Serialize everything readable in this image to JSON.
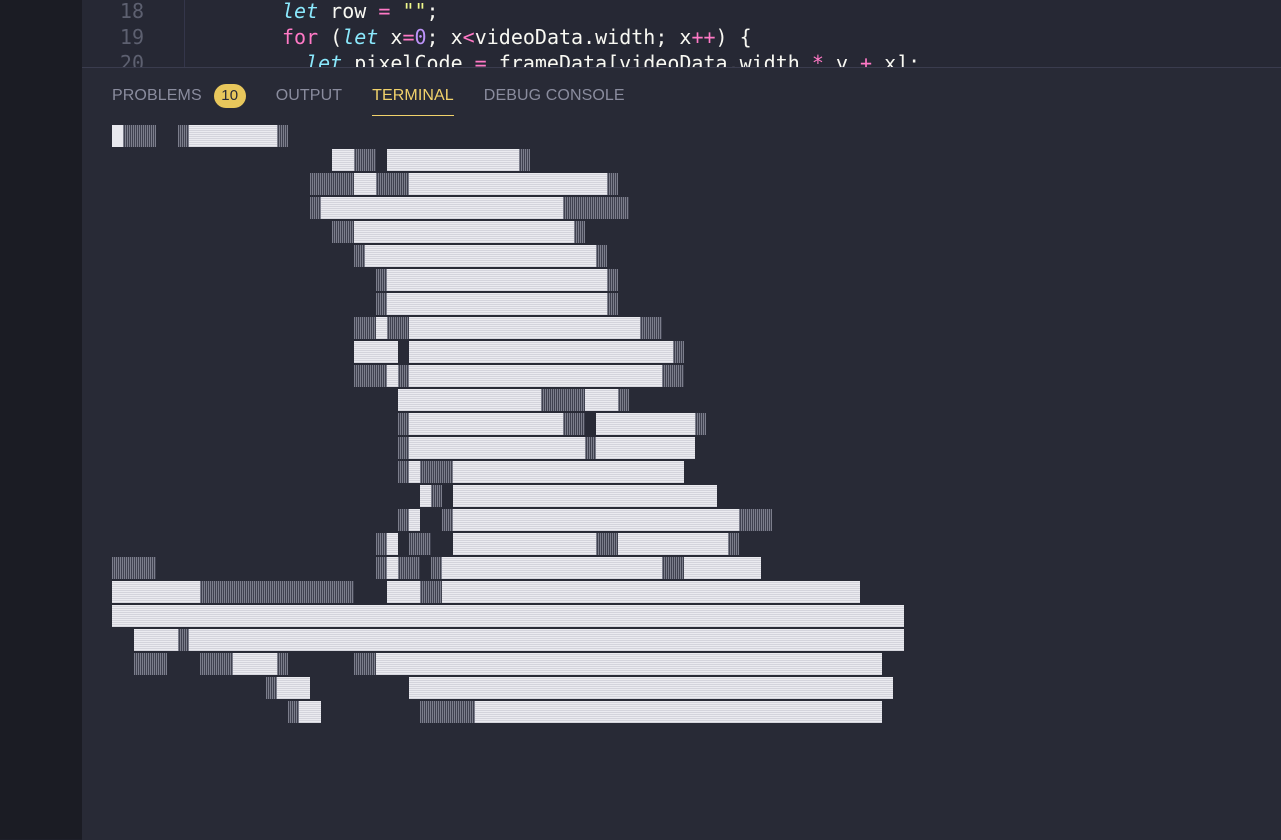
{
  "editor": {
    "lines": [
      {
        "number": "18",
        "tokens": [
          {
            "c": "kw-let",
            "t": "let"
          },
          {
            "c": "",
            "t": " row "
          },
          {
            "c": "op",
            "t": "="
          },
          {
            "c": "",
            "t": " "
          },
          {
            "c": "str",
            "t": "\"\""
          },
          {
            "c": "",
            "t": ";"
          }
        ]
      },
      {
        "number": "19",
        "tokens": [
          {
            "c": "kw-for",
            "t": "for"
          },
          {
            "c": "",
            "t": " ("
          },
          {
            "c": "kw-let",
            "t": "let"
          },
          {
            "c": "",
            "t": " x"
          },
          {
            "c": "op",
            "t": "="
          },
          {
            "c": "num",
            "t": "0"
          },
          {
            "c": "",
            "t": "; x"
          },
          {
            "c": "op",
            "t": "<"
          },
          {
            "c": "",
            "t": "videoData.width; x"
          },
          {
            "c": "op",
            "t": "++"
          },
          {
            "c": "",
            "t": ") {"
          }
        ]
      },
      {
        "number": "20",
        "tokens": [
          {
            "c": "",
            "t": "  "
          },
          {
            "c": "kw-let",
            "t": "let"
          },
          {
            "c": "",
            "t": " pixelCode "
          },
          {
            "c": "op",
            "t": "="
          },
          {
            "c": "",
            "t": " frameData[videoData.width "
          },
          {
            "c": "op",
            "t": "*"
          },
          {
            "c": "",
            "t": " y "
          },
          {
            "c": "op",
            "t": "+"
          },
          {
            "c": "",
            "t": " x];"
          }
        ]
      }
    ]
  },
  "panel": {
    "tabs": [
      {
        "label": "PROBLEMS",
        "badge": "10",
        "active": false
      },
      {
        "label": "OUTPUT",
        "active": false
      },
      {
        "label": "TERMINAL",
        "active": true
      },
      {
        "label": "DEBUG CONSOLE",
        "active": false
      }
    ]
  },
  "terminal": {
    "rows": [
      "FMMM  MFFFFFFFFM",
      "                    FFMM FFFFFFFFFFFFM",
      "                  MMMMFFMMMFFFFFFFFFFFFFFFFFFM",
      "                  MFFFFFFFFFFFFFFFFFFFFFFMMMMMM",
      "                    MMFFFFFFFFFFFFFFFFFFFFM",
      "                      MFFFFFFFFFFFFFFFFFFFFFM",
      "                        MFFFFFFFFFFFFFFFFFFFFM",
      "                        MFFFFFFFFFFFFFFFFFFFFM",
      "                      MMFMMFFFFFFFFFFFFFFFFFFFFFMM",
      "                      FFFF FFFFFFFFFFFFFFFFFFFFFFFFM",
      "                      MMMFMFFFFFFFFFFFFFFFFFFFFFFFMM",
      "                          FFFFFFFFFFFFFMMMMFFFM",
      "                          MFFFFFFFFFFFFFFMM FFFFFFFFFM",
      "                          MFFFFFFFFFFFFFFFFMFFFFFFFFF",
      "                          MFMMMFFFFFFFFFFFFFFFFFFFFF",
      "                            FM FFFFFFFFFFFFFFFFFFFFFFFF",
      "                          MF  MFFFFFFFFFFFFFFFFFFFFFFFFFFMMM",
      "                        MF MM  FFFFFFFFFFFFFMMFFFFFFFFFFM",
      "MMMM                    MFMM MFFFFFFFFFFFFFFFFFFFFMMFFFFFFF",
      "FFFFFFFFMMMMMMMMMMMMMM   FFFMMFFFFFFFFFFFFFFFFFFFFFFFFFFFFFFFFFFFFFF",
      "FFFFFFFFFFFFFFFFFFFFFFFFFFFFFFFFFFFFFFFFFFFFFFFFFFFFFFFFFFFFFFFFFFFFFFFF",
      "  FFFFMFFFFFFFFFFFFFFFFFFFFFFFFFFFFFFFFFFFFFFFFFFFFFFFFFFFFFFFFFFFFFFFFF",
      "  MMM   MMMFFFFM      MMFFFFFFFFFFFFFFFFFFFFFFFFFFFFFFFFFFFFFFFFFFFFFF",
      "              MFFF         FFFFFFFFFFFFFFFFFFFFFFFFFFFFFFFFFFFFFFFFFFFF",
      "                MFF         MMMMMFFFFFFFFFFFFFFFFFFFFFFFFFFFFFFFFFFFFF"
    ]
  },
  "colors": {
    "active_tab": "#f1d26b",
    "badge": "#e8c75c",
    "panel_bg": "#282a36"
  }
}
